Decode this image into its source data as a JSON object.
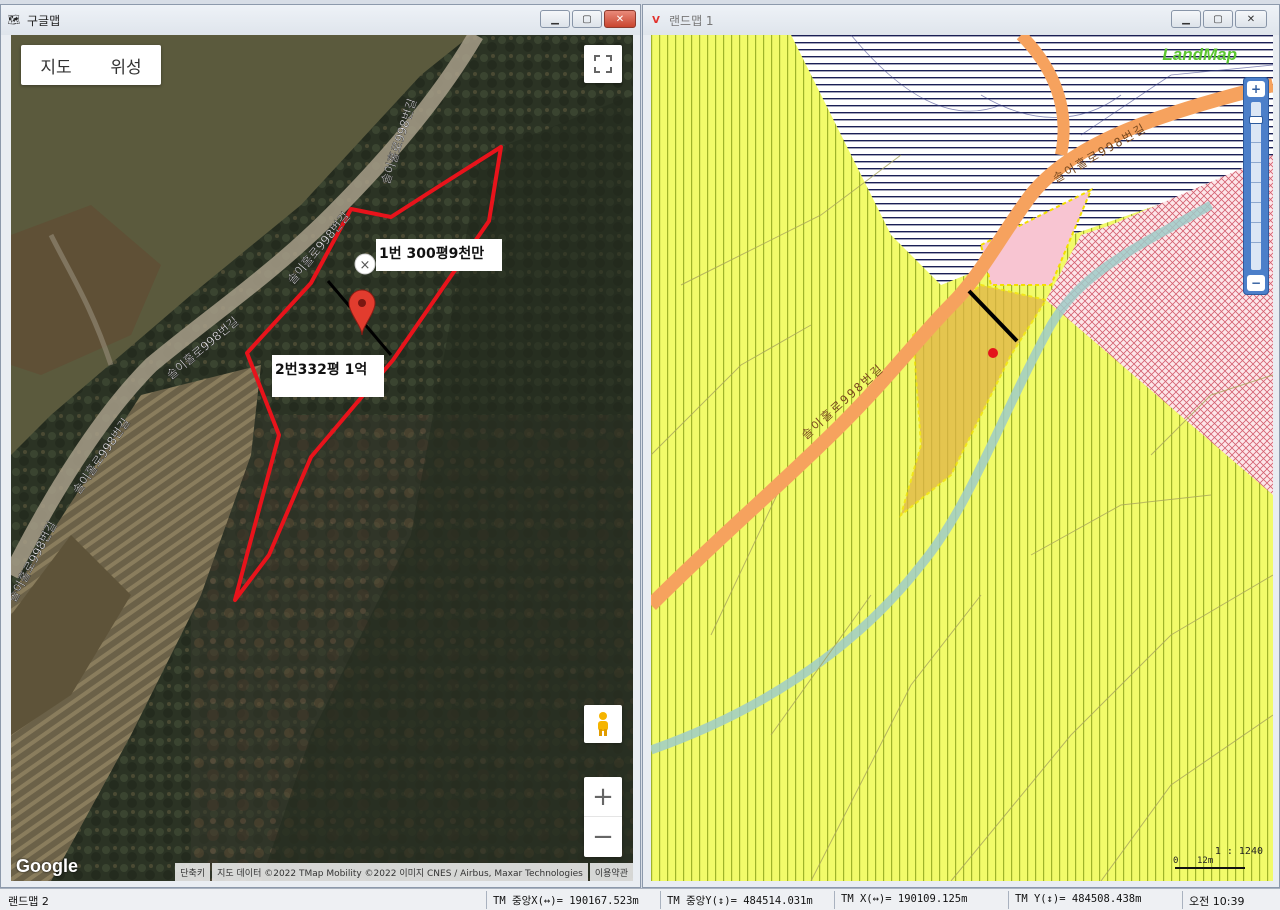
{
  "google_window": {
    "title": "구글맵",
    "maptype": {
      "map_label": "지도",
      "satellite_label": "위성"
    },
    "labels": {
      "lot1": "1번 300평9천만",
      "lot2": "2번332평 1억"
    },
    "road_label": "솔이홀로998번길",
    "logo": "Google",
    "attribution": {
      "shortcuts": "단축키",
      "data": "지도 데이터 ©2022 TMap Mobility ©2022 이미지 CNES / Airbus, Maxar Technologies",
      "terms": "이용약관"
    },
    "controls": {
      "zoom_in": "+",
      "zoom_out": "−"
    }
  },
  "landmap_window": {
    "title": "랜드맵 1",
    "logo": "LandMap",
    "road_label": "솔이홀로998번길",
    "scale": {
      "ratio": "1 : 1240",
      "zero": "0",
      "distance": "12m"
    },
    "zoom": {
      "in": "+",
      "out": "−"
    }
  },
  "window_controls": {
    "minimize": "▁",
    "maximize": "▢",
    "close": "✕"
  },
  "statusbar": {
    "app": "랜드맵 2",
    "tm_center_x": "TM 중앙X(↔)= 190167.523m",
    "tm_center_y": "TM 중앙Y(↕)= 484514.031m",
    "tm_x": "TM X(↔)= 190109.125m",
    "tm_y": "TM Y(↕)= 484508.438m",
    "clock": "오전 10:39"
  }
}
